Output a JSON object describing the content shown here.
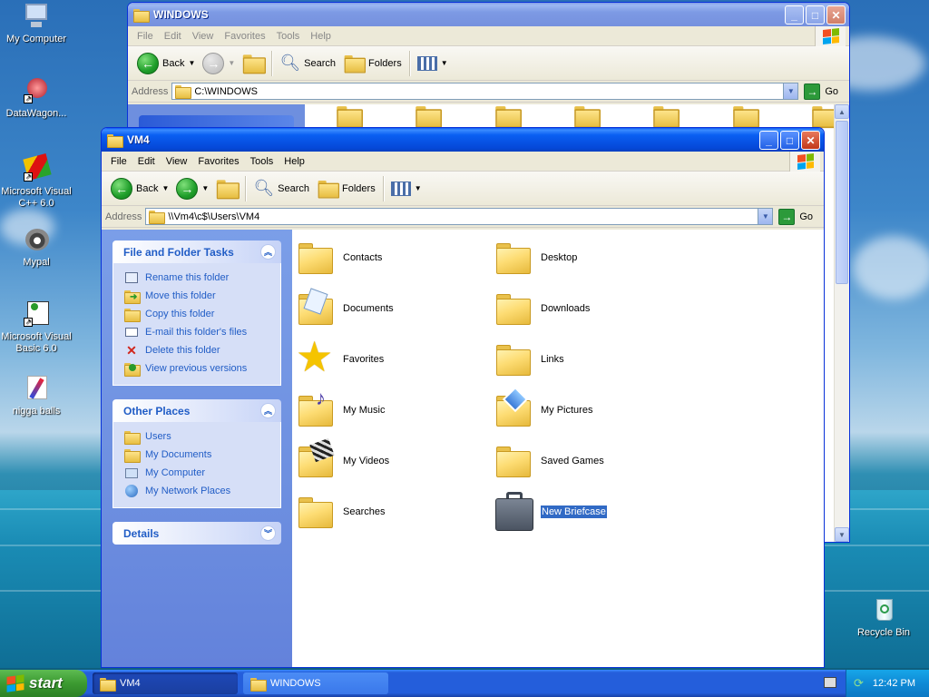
{
  "desktop": {
    "icons": [
      {
        "label": "My Computer"
      },
      {
        "label": "DataWagon..."
      },
      {
        "label": "Microsoft Visual C++ 6.0"
      },
      {
        "label": "Mypal"
      },
      {
        "label": "Microsoft Visual Basic 6.0"
      },
      {
        "label": "nigga balls"
      },
      {
        "label": "Recycle Bin"
      }
    ]
  },
  "back_window": {
    "title": "WINDOWS",
    "menu": [
      "File",
      "Edit",
      "View",
      "Favorites",
      "Tools",
      "Help"
    ],
    "toolbar": {
      "back": "Back",
      "search": "Search",
      "folders": "Folders"
    },
    "address_label": "Address",
    "address_value": "C:\\WINDOWS",
    "go": "Go"
  },
  "front_window": {
    "title": "VM4",
    "menu": [
      "File",
      "Edit",
      "View",
      "Favorites",
      "Tools",
      "Help"
    ],
    "toolbar": {
      "back": "Back",
      "search": "Search",
      "folders": "Folders"
    },
    "address_label": "Address",
    "address_value": "\\\\Vm4\\c$\\Users\\VM4",
    "go": "Go",
    "task_panels": [
      {
        "title": "File and Folder Tasks",
        "items": [
          "Rename this folder",
          "Move this folder",
          "Copy this folder",
          "E-mail this folder's files",
          "Delete this folder",
          "View previous versions"
        ]
      },
      {
        "title": "Other Places",
        "items": [
          "Users",
          "My Documents",
          "My Computer",
          "My Network Places"
        ]
      },
      {
        "title": "Details",
        "items": []
      }
    ],
    "files": [
      {
        "name": "Contacts",
        "icon": "folder-icon"
      },
      {
        "name": "Desktop",
        "icon": "folder-icon"
      },
      {
        "name": "Documents",
        "icon": "documents-folder-icon"
      },
      {
        "name": "Downloads",
        "icon": "folder-icon"
      },
      {
        "name": "Favorites",
        "icon": "star-icon"
      },
      {
        "name": "Links",
        "icon": "folder-icon"
      },
      {
        "name": "My Music",
        "icon": "music-folder-icon"
      },
      {
        "name": "My Pictures",
        "icon": "pictures-folder-icon"
      },
      {
        "name": "My Videos",
        "icon": "videos-folder-icon"
      },
      {
        "name": "Saved Games",
        "icon": "folder-icon"
      },
      {
        "name": "Searches",
        "icon": "folder-icon"
      },
      {
        "name": "New Briefcase",
        "icon": "briefcase-icon",
        "selected": true
      }
    ]
  },
  "taskbar": {
    "start": "start",
    "items": [
      {
        "label": "VM4"
      },
      {
        "label": "WINDOWS"
      }
    ],
    "clock": "12:42 PM"
  },
  "colors": {
    "accent": "#0a5ff2",
    "task_link": "#215dc6",
    "selection": "#316ac5"
  }
}
